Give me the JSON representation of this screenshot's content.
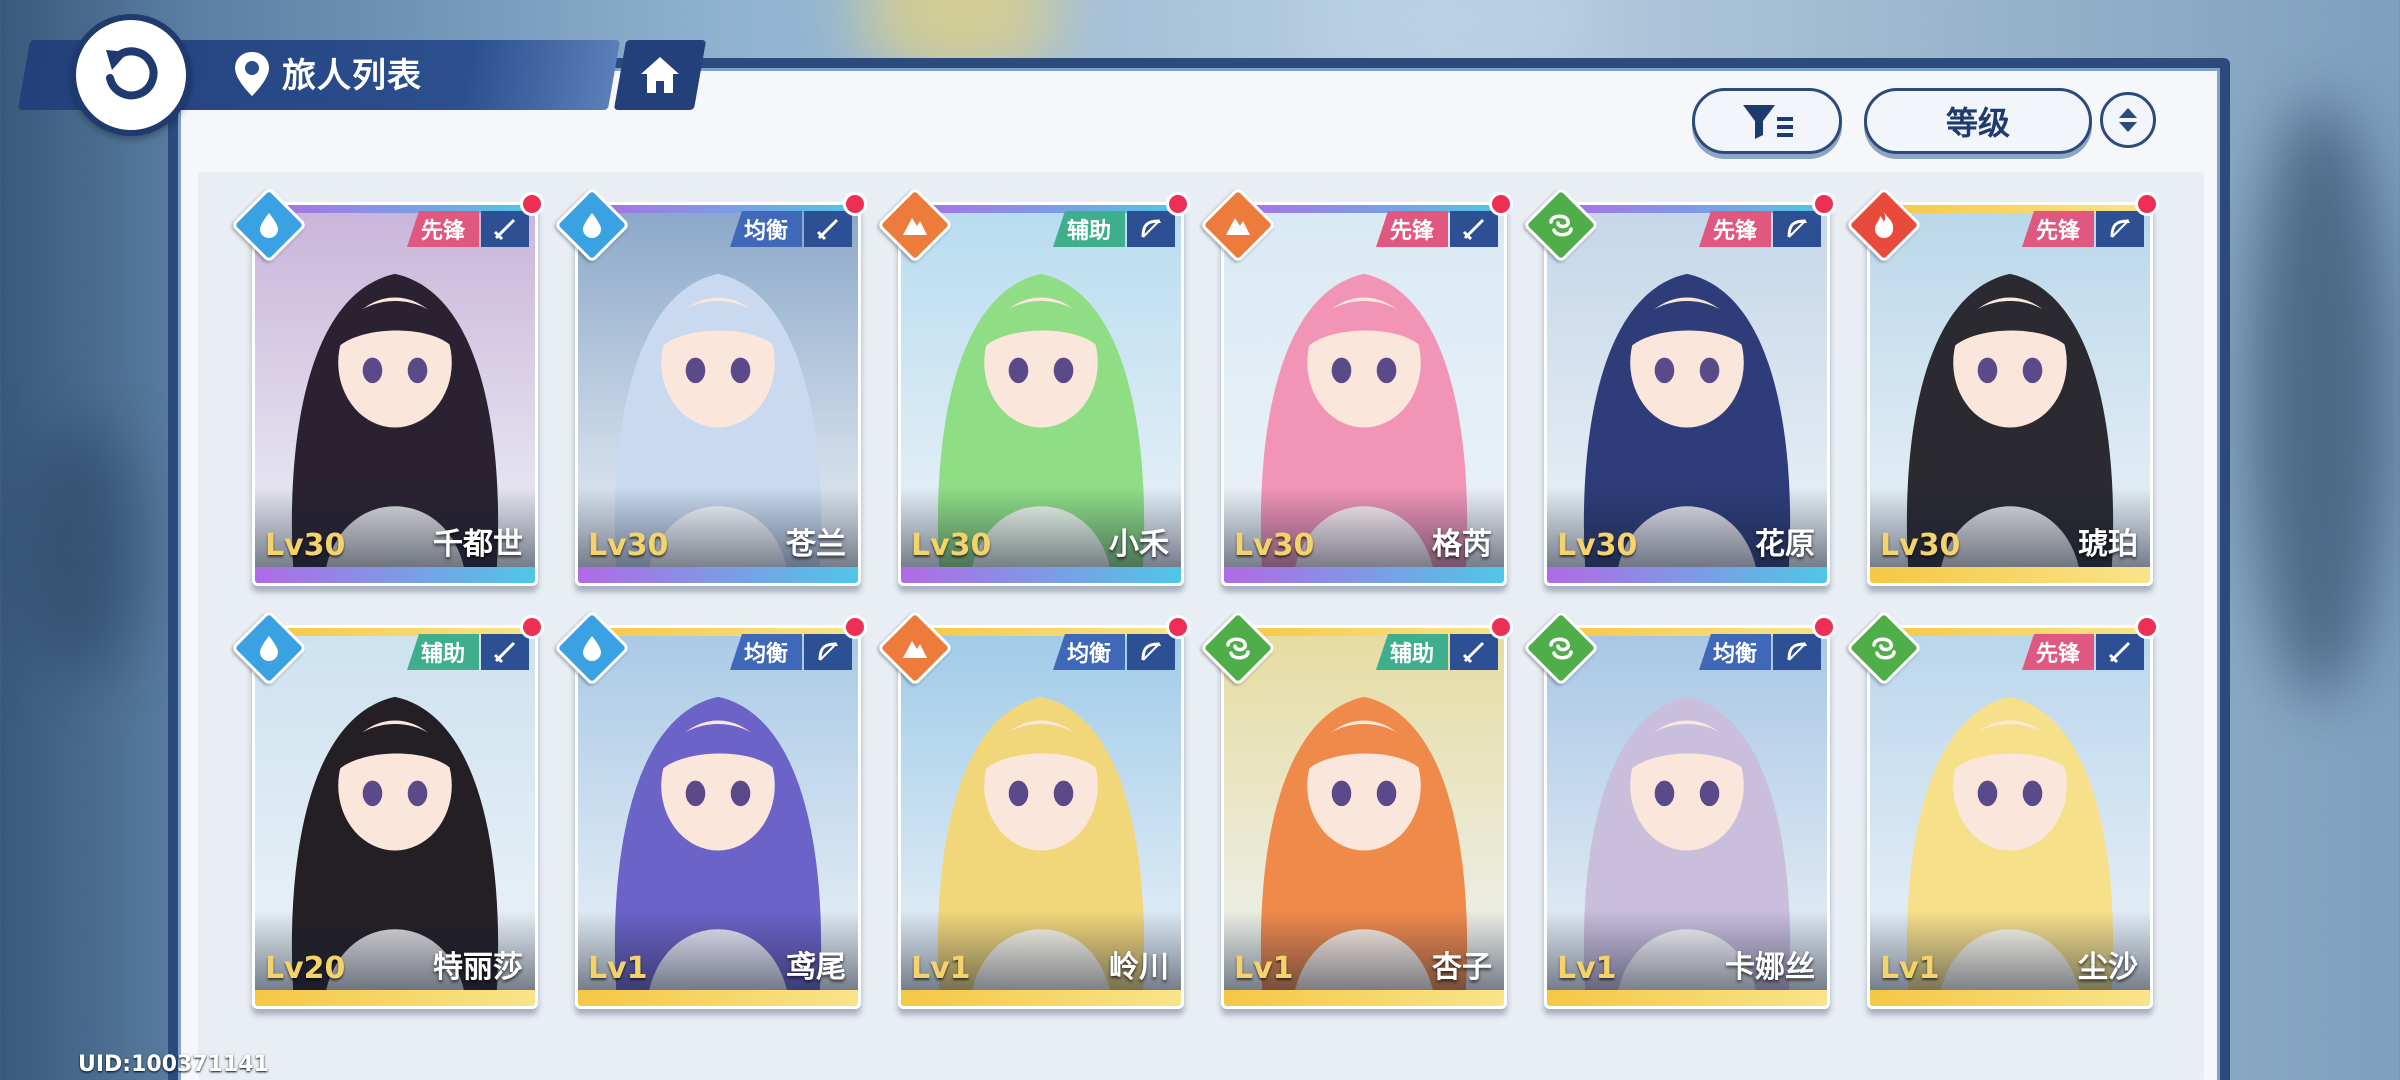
{
  "header": {
    "title": "旅人列表"
  },
  "toolbar": {
    "sort_label": "等级"
  },
  "uid": "UID:100371141",
  "colors": {
    "accent": "#2c4a7c",
    "notify": "#ee2f55",
    "level": "#f4d36a"
  },
  "cards": [
    {
      "level": "Lv30",
      "name": "千都世",
      "role": "先锋",
      "element": "water",
      "weapon": "sword-icon",
      "rarity": "purple",
      "hair": "#2a2230",
      "bg": "#c9b4d9"
    },
    {
      "level": "Lv30",
      "name": "苍兰",
      "role": "均衡",
      "element": "water",
      "weapon": "sword-icon",
      "rarity": "purple",
      "hair": "#c9d9ef",
      "bg": "#8aa7c8"
    },
    {
      "level": "Lv30",
      "name": "小禾",
      "role": "辅助",
      "element": "earth",
      "weapon": "bow-icon",
      "rarity": "purple",
      "hair": "#8fde86",
      "bg": "#b7dcef"
    },
    {
      "level": "Lv30",
      "name": "格芮",
      "role": "先锋",
      "element": "earth",
      "weapon": "sword-icon",
      "rarity": "purple",
      "hair": "#f294b6",
      "bg": "#d9e9f4"
    },
    {
      "level": "Lv30",
      "name": "花原",
      "role": "先锋",
      "element": "wind",
      "weapon": "bow-icon",
      "rarity": "purple",
      "hair": "#2e3d7a",
      "bg": "#c4d6e8"
    },
    {
      "level": "Lv30",
      "name": "琥珀",
      "role": "先锋",
      "element": "fire",
      "weapon": "bow-icon",
      "rarity": "gold",
      "hair": "#2a2a30",
      "bg": "#b9d7ea"
    },
    {
      "level": "Lv20",
      "name": "特丽莎",
      "role": "辅助",
      "element": "water",
      "weapon": "sword-icon",
      "rarity": "gold",
      "hair": "#241f24",
      "bg": "#cde2ef"
    },
    {
      "level": "Lv1",
      "name": "鸢尾",
      "role": "均衡",
      "element": "water",
      "weapon": "bow-icon",
      "rarity": "gold",
      "hair": "#6c63c8",
      "bg": "#a9c9e6"
    },
    {
      "level": "Lv1",
      "name": "岭川",
      "role": "均衡",
      "element": "earth",
      "weapon": "bow-icon",
      "rarity": "gold",
      "hair": "#f2d77a",
      "bg": "#9fcbe8"
    },
    {
      "level": "Lv1",
      "name": "杏子",
      "role": "辅助",
      "element": "wind",
      "weapon": "sword-icon",
      "rarity": "gold",
      "hair": "#f08a4b",
      "bg": "#e6dca0"
    },
    {
      "level": "Lv1",
      "name": "卡娜丝",
      "role": "均衡",
      "element": "wind",
      "weapon": "bow-icon",
      "rarity": "gold",
      "hair": "#c9bedc",
      "bg": "#a7c6e4"
    },
    {
      "level": "Lv1",
      "name": "尘沙",
      "role": "先锋",
      "element": "wind",
      "weapon": "sword-icon",
      "rarity": "gold",
      "hair": "#f7e08a",
      "bg": "#b9d6ec"
    }
  ]
}
